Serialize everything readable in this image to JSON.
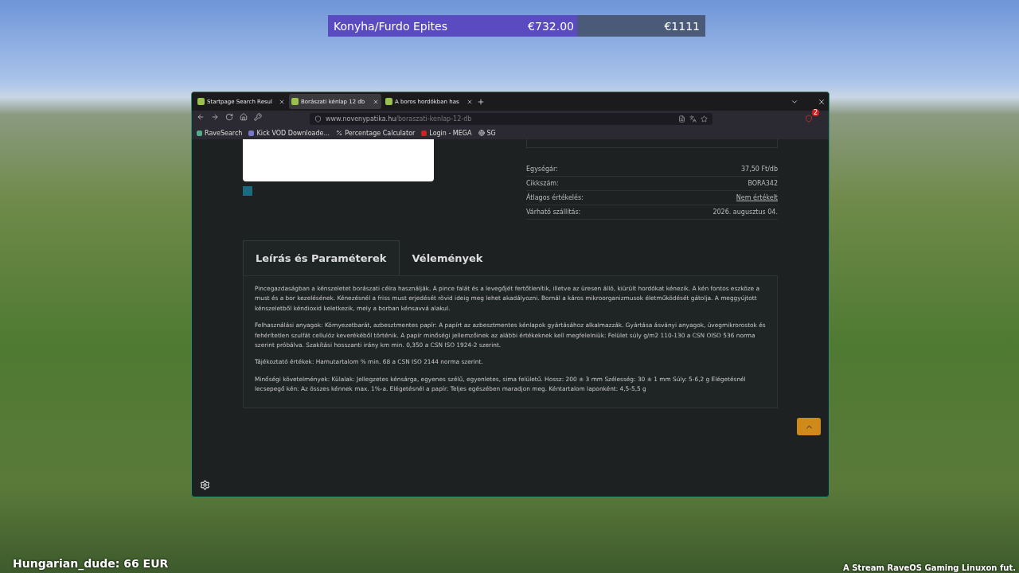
{
  "goal_bar": {
    "label": "Konyha/Furdo Epites",
    "current": "€732.00",
    "target": "€1111",
    "level": 0.66
  },
  "browser": {
    "tabs": [
      {
        "label": "Startpage Search Resul",
        "selected": false
      },
      {
        "label": "Borászati kénlap 12 db",
        "selected": true
      },
      {
        "label": "A boros hordókban has",
        "selected": false
      }
    ],
    "url_domain": "www.novenypatika.hu",
    "url_path": "/boraszati-kenlap-12-db",
    "extension_badge": "2",
    "bookmarks": [
      "RaveSearch",
      "Kick VOD Downloade...",
      "Percentage Calculator",
      "Login - MEGA",
      "SG"
    ]
  },
  "product": {
    "details": [
      {
        "label": "Egységár:",
        "value": "37,50 Ft/db",
        "link": false
      },
      {
        "label": "Cikkszám:",
        "value": "BORA342",
        "link": false
      },
      {
        "label": "Átlagos értékelés:",
        "value": "Nem értékelt",
        "link": true
      },
      {
        "label": "Várható szállítás:",
        "value": "2026. augusztus 04.",
        "link": false
      }
    ],
    "tabs": [
      {
        "label": "Leírás és Paraméterek",
        "selected": true
      },
      {
        "label": "Vélemények",
        "selected": false
      }
    ],
    "paragraphs": [
      "Pincegazdaságban a kénszeletet borászati célra használják. A pince falát és a levegőjét fertőtlenítik, illetve az üresen álló, kiürült hordókat kénezik. A kén fontos eszköze a must és a bor kezelésének. Kénezésnél a friss must erjedését rövid ideig meg lehet akadályozni. Bornál a káros mikroorganizmusok életműködését gátolja. A meggyújtott kénszeletből kéndioxid keletkezik, mely a borban kénsavvá alakul.",
      "Felhasználási anyagok: Környezetbarát, azbesztmentes papír: A papírt az azbesztmentes kénlapok gyártásához alkalmazzák. Gyártása ásványi anyagok, üvegmikrorostok és fehérítetlen szulfát cellulóz keverékéből történik. A papír minőségi jellemzőinek az alábbi értékeknek kell megfelelniük: Felület súly g/m2 110-130 a CSN OISO 536 norma szerint próbálva. Szakítási hosszanti irány km min. 0,350 a CSN ISO 1924-2 szerint.",
      "Tájékoztató értékek: Hamutartalom % min. 68 a CSN ISO 2144 norma szerint.",
      "Minőségi követelmények: Külalak: Jellegzetes kénsárga, egyenes szélű, egyenletes, sima felületű. Hossz: 200 ± 3 mm Szélesség: 30 ± 1 mm Súly: 5-6,2 g Elégetésnél lecsepegő kén: Az összes kénnek max. 1%-a. Elégetésnél a papír: Teljes egészében maradjon meg. Kéntartalom laponként: 4,5-5,5 g"
    ]
  },
  "stream_overlay": {
    "donation": "Hungarian_dude: 66 EUR",
    "ticker": "A Stream RaveOS Gaming Linuxon fut."
  }
}
